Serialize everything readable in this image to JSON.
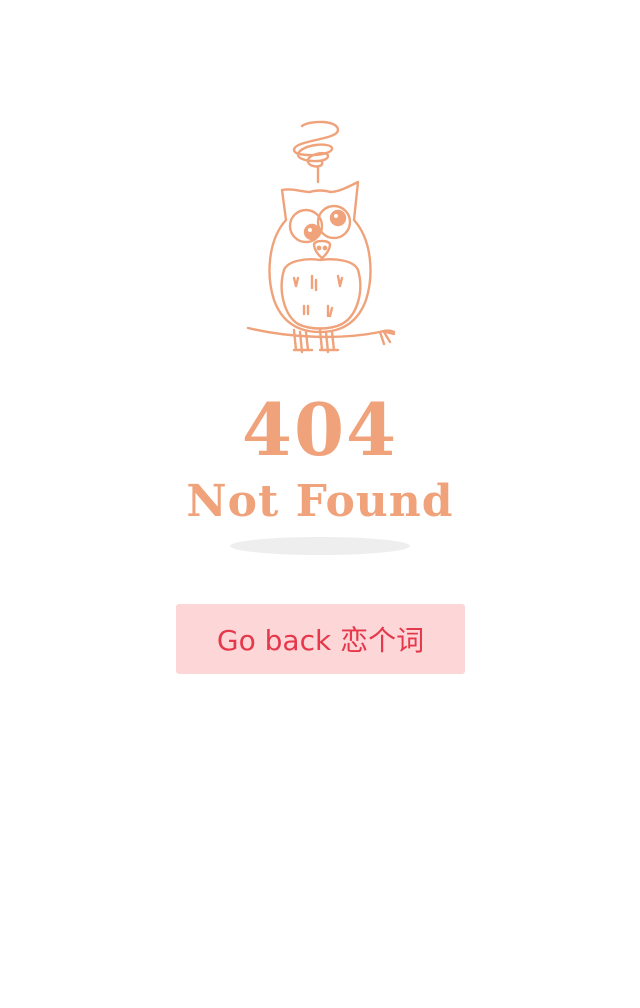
{
  "error": {
    "code": "404",
    "message": "Not Found"
  },
  "actions": {
    "back_label": "Go back 恋个词"
  },
  "colors": {
    "accent": "#f0a27a",
    "button_bg": "#fdd6d7",
    "button_text": "#e5384a",
    "shadow": "#eeeeee"
  },
  "icons": {
    "illustration": "confused-owl-illustration"
  }
}
